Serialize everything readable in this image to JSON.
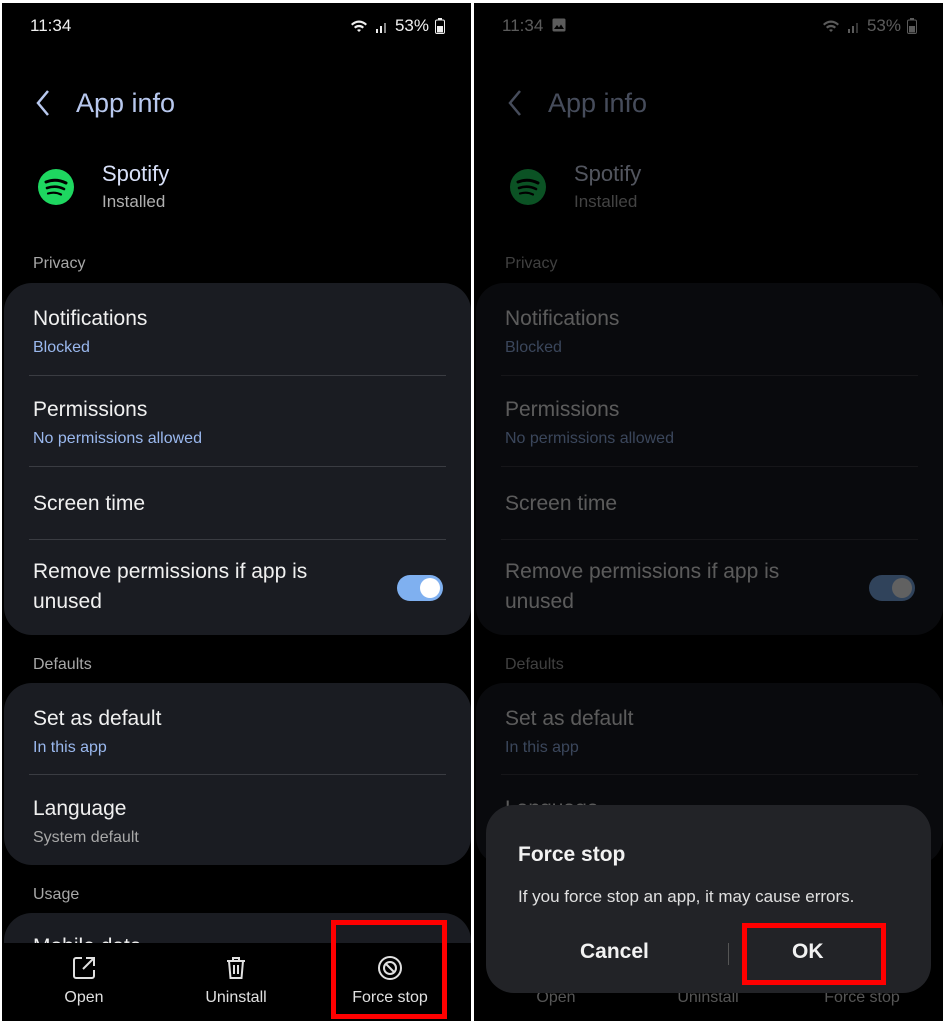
{
  "status": {
    "time": "11:34",
    "battery": "53%"
  },
  "header": {
    "title": "App info"
  },
  "app": {
    "name": "Spotify",
    "status": "Installed"
  },
  "sections": {
    "privacy": "Privacy",
    "defaults": "Defaults",
    "usage": "Usage"
  },
  "privacy_items": {
    "notifications": {
      "title": "Notifications",
      "sub": "Blocked"
    },
    "permissions": {
      "title": "Permissions",
      "sub": "No permissions allowed"
    },
    "screen_time": {
      "title": "Screen time"
    },
    "remove_permissions": {
      "line1": "Remove permissions if app is",
      "line2": "unused",
      "enabled": true
    }
  },
  "default_items": {
    "set_default": {
      "title": "Set as default",
      "sub": "In this app"
    },
    "language": {
      "title": "Language",
      "sub": "System default"
    }
  },
  "usage_items": {
    "mobile_data": "Mobile data"
  },
  "bottom_bar": {
    "open": "Open",
    "uninstall": "Uninstall",
    "force_stop": "Force stop"
  },
  "dialog": {
    "title": "Force stop",
    "message": "If you force stop an app, it may cause errors.",
    "cancel": "Cancel",
    "ok": "OK"
  },
  "colors": {
    "highlight": "#ff0000",
    "accent": "#9ab8ee",
    "card": "#1a1c22"
  },
  "icons": [
    "chevron-left-icon",
    "spotify-logo",
    "wifi-icon",
    "signal-icon",
    "battery-icon",
    "gallery-icon",
    "open-external-icon",
    "trash-icon",
    "block-icon"
  ]
}
